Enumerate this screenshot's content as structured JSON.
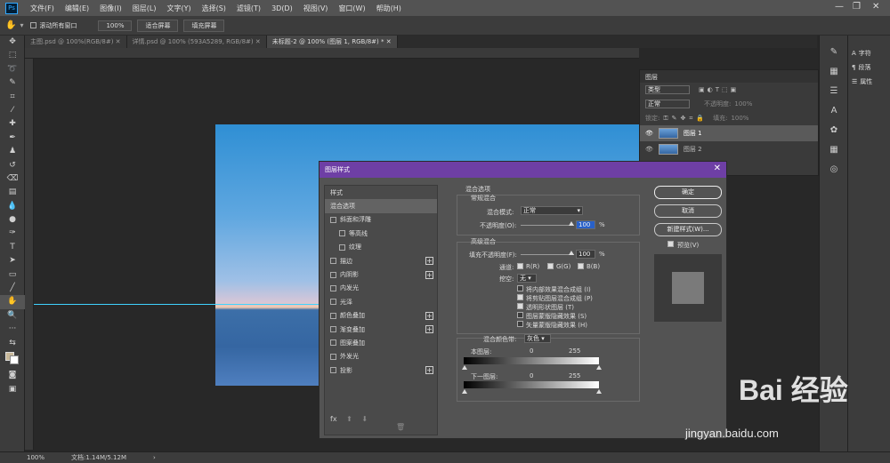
{
  "menubar": {
    "logo": "Ps",
    "items": [
      "文件(F)",
      "编辑(E)",
      "图像(I)",
      "图层(L)",
      "文字(Y)",
      "选择(S)",
      "滤镜(T)",
      "3D(D)",
      "视图(V)",
      "窗口(W)",
      "帮助(H)"
    ]
  },
  "options": {
    "scroll_all": "滚动所有窗口",
    "zoom": "100%",
    "fit_screen": "适合屏幕",
    "fill_screen": "填充屏幕"
  },
  "tabs": [
    "主图.psd @ 100%(RGB/8#)",
    "详情.psd @ 100% (593A5289, RGB/8#)",
    "未标题-2 @ 100% (图层 1, RGB/8#) *"
  ],
  "status": {
    "zoom": "100%",
    "doc": "文档:1.14M/5.12M"
  },
  "layers_panel": {
    "title": "图层",
    "kind": "类型",
    "mode": "正常",
    "opacity_label": "不透明度:",
    "opacity_value": "100%",
    "lock_label": "锁定:",
    "fill_label": "填充:",
    "fill_value": "100%",
    "layers": [
      "图层 1",
      "图层 2"
    ]
  },
  "dock": {
    "items": [
      "字符",
      "段落",
      "属性"
    ]
  },
  "dialog": {
    "title": "图层样式",
    "styles_header": "样式",
    "styles": [
      {
        "label": "混合选项",
        "type": "sel"
      },
      {
        "label": "斜面和浮雕",
        "type": "cb"
      },
      {
        "label": "等高线",
        "type": "sub"
      },
      {
        "label": "纹理",
        "type": "sub"
      },
      {
        "label": "描边",
        "type": "plus"
      },
      {
        "label": "内阴影",
        "type": "plus"
      },
      {
        "label": "内发光",
        "type": "cb"
      },
      {
        "label": "光泽",
        "type": "cb"
      },
      {
        "label": "颜色叠加",
        "type": "plus"
      },
      {
        "label": "渐变叠加",
        "type": "plus"
      },
      {
        "label": "图案叠加",
        "type": "cb"
      },
      {
        "label": "外发光",
        "type": "cb"
      },
      {
        "label": "投影",
        "type": "plus"
      }
    ],
    "fx": "fx",
    "blend_options": "混合选项",
    "general_blending": "常规混合",
    "blend_mode_label": "混合模式:",
    "blend_mode_value": "正常",
    "opacity_label": "不透明度(O):",
    "opacity_value": "100",
    "pct": "%",
    "advanced_blending": "高级混合",
    "fill_opacity_label": "填充不透明度(F):",
    "fill_opacity_value": "100",
    "channels_label": "通道:",
    "ch_r": "R(R)",
    "ch_g": "G(G)",
    "ch_b": "B(B)",
    "knockout_label": "挖空:",
    "knockout_value": "无",
    "opt1": "将内部效果混合成组 (I)",
    "opt2": "将剪贴图层混合成组 (P)",
    "opt3": "透明形状图层 (T)",
    "opt4": "图层蒙版隐藏效果 (S)",
    "opt5": "矢量蒙版隐藏效果 (H)",
    "blend_if_label": "混合颜色带:",
    "blend_if_value": "灰色",
    "this_layer": "本图层:",
    "underlying": "下一图层:",
    "v0": "0",
    "v255": "255",
    "ok": "确定",
    "cancel": "取消",
    "new_style": "新建样式(W)...",
    "preview": "预览(V)"
  },
  "watermark": {
    "brand": "Bai 经验",
    "url": "jingyan.baidu.com"
  }
}
